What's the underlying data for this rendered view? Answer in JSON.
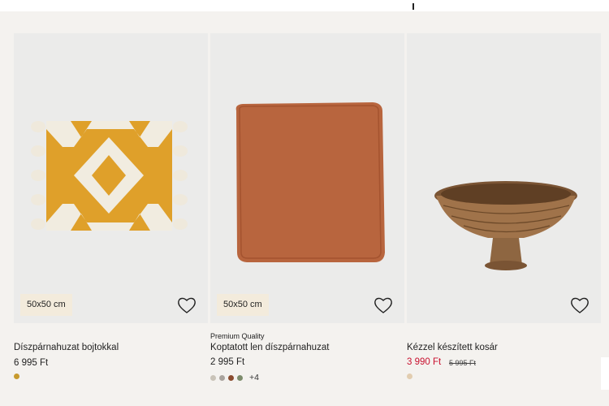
{
  "products": [
    {
      "size_badge": "50x50 cm",
      "premium": "",
      "name": "Díszpárnahuzat bojtokkal",
      "price": "6 995 Ft",
      "old_price": "",
      "swatches": [
        "#c79a2e"
      ],
      "more_colors": "",
      "image": "mustard-tassel-cushion"
    },
    {
      "size_badge": "50x50 cm",
      "premium": "Premium Quality",
      "name": "Koptatott len díszpárnahuzat",
      "price": "2 995 Ft",
      "old_price": "",
      "swatches": [
        "#c9c3b8",
        "#a9a39d",
        "#8a4b2e",
        "#7c8b6b"
      ],
      "more_colors": "+4",
      "image": "rust-linen-cushion"
    },
    {
      "size_badge": "",
      "premium": "",
      "name": "Kézzel készített kosár",
      "price": "3 990 Ft",
      "old_price": "5 995 Ft",
      "swatches": [
        "#e2cdb0"
      ],
      "more_colors": "",
      "image": "woven-footed-basket"
    }
  ],
  "icons": {
    "favorite": "heart-outline-icon"
  },
  "colors": {
    "sale_price": "#c8102e",
    "badge_bg": "#f3ebdc",
    "page_bg": "#f4f2ef"
  }
}
